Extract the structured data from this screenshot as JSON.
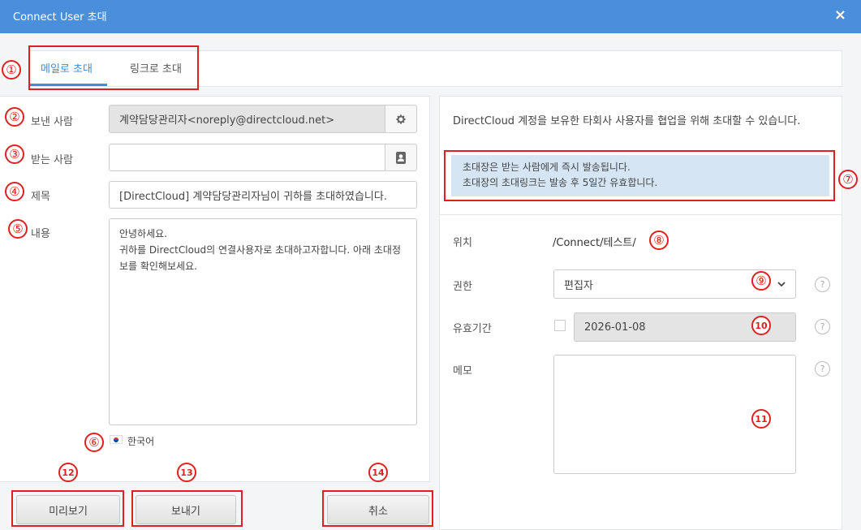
{
  "window": {
    "title": "Connect User 초대",
    "close_icon": "×"
  },
  "tabs": [
    {
      "label": "메일로 초대",
      "active": true
    },
    {
      "label": "링크로 초대",
      "active": false
    }
  ],
  "form": {
    "sender_label": "보낸 사람",
    "sender_value": "계약담당관리자<noreply@directcloud.net>",
    "recipient_label": "받는 사람",
    "recipient_value": "",
    "subject_label": "제목",
    "subject_value": "[DirectCloud] 계약담당관리자님이 귀하를 초대하였습니다.",
    "body_label": "내용",
    "body_value": "안녕하세요.\n귀하를 DirectCloud의 연결사용자로 초대하고자합니다. 아래 초대정보를 확인해보세요.",
    "language": "한국어"
  },
  "buttons": {
    "preview": "미리보기",
    "send": "보내기",
    "cancel": "취소"
  },
  "info": {
    "description": "DirectCloud 계정을 보유한 타회사 사용자를 협업을 위해 초대할 수 있습니다.",
    "notice_line1": "초대장은 받는 사람에게 즉시 발송됩니다.",
    "notice_line2": "초대장의 초대링크는 발송 후 5일간 유효합니다."
  },
  "settings": {
    "location_label": "위치",
    "location_value": "/Connect/테스트/",
    "permission_label": "권한",
    "permission_value": "편집자",
    "expiry_label": "유효기간",
    "expiry_value": "2026-01-08",
    "memo_label": "메모",
    "memo_value": "",
    "help_glyph": "?"
  },
  "markers": [
    "①",
    "②",
    "③",
    "④",
    "⑤",
    "⑥",
    "⑦",
    "⑧",
    "⑨",
    "10",
    "11",
    "12",
    "13",
    "14"
  ],
  "colors": {
    "titlebar": "#4a8fdb",
    "accent": "#3b8ddd",
    "marker": "#e02020",
    "notice_bg": "#d5e5f4"
  }
}
